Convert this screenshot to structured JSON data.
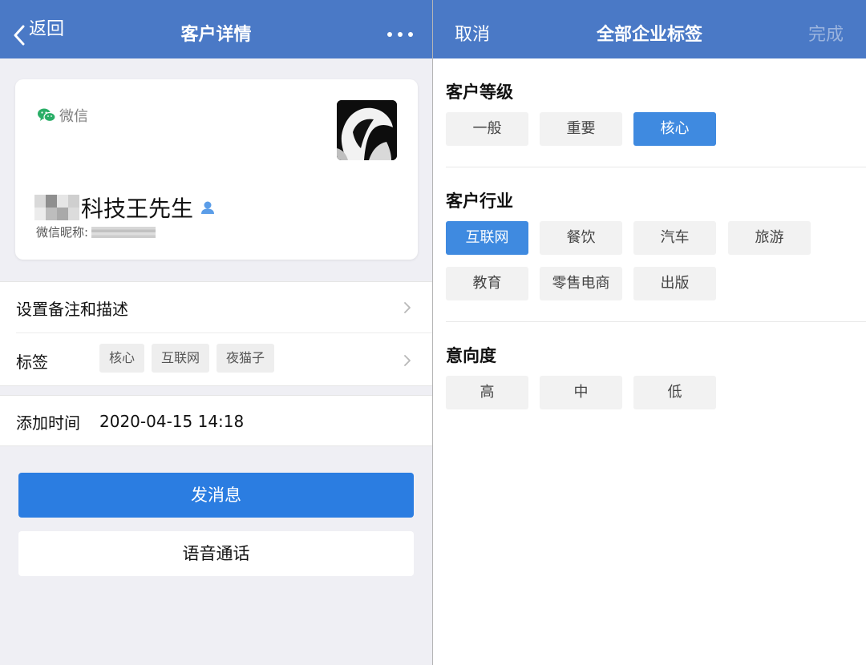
{
  "left": {
    "header": {
      "back_label": "返回",
      "title": "客户详情"
    },
    "card": {
      "source_label": "微信",
      "customer_name": "科技王先生",
      "nickname_label": "微信昵称:"
    },
    "remark_label": "设置备注和描述",
    "tags_label": "标签",
    "tags": [
      "核心",
      "互联网",
      "夜猫子"
    ],
    "added_time_label": "添加时间",
    "added_time_value": "2020-04-15 14:18",
    "send_message_label": "发消息",
    "voice_call_label": "语音通话"
  },
  "right": {
    "header": {
      "cancel_label": "取消",
      "title": "全部企业标签",
      "done_label": "完成"
    },
    "sections": [
      {
        "title": "客户等级",
        "options": [
          "一般",
          "重要",
          "核心"
        ],
        "selected": "核心"
      },
      {
        "title": "客户行业",
        "options": [
          "互联网",
          "餐饮",
          "汽车",
          "旅游",
          "教育",
          "零售电商",
          "出版"
        ],
        "selected": "互联网"
      },
      {
        "title": "意向度",
        "options": [
          "高",
          "中",
          "低"
        ],
        "selected": null
      }
    ]
  },
  "colors": {
    "header_bg": "#4a79c6",
    "primary_button": "#2b7de1",
    "selected_chip": "#3f8ae0",
    "wechat_green": "#2aae67",
    "done_disabled": "#9bb4de"
  },
  "icons": [
    "back-chevron-icon",
    "more-icon",
    "wechat-icon",
    "contact-person-icon",
    "chevron-right-icon"
  ]
}
